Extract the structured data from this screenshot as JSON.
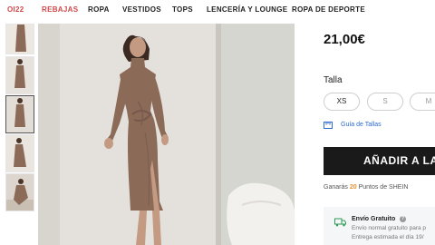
{
  "nav": {
    "items": [
      {
        "label": "OI22",
        "accent": true
      },
      {
        "label": "REBAJAS",
        "accent": true
      },
      {
        "label": "ROPA",
        "accent": false
      },
      {
        "label": "VESTIDOS",
        "accent": false
      },
      {
        "label": "TOPS",
        "accent": false
      },
      {
        "label": "LENCERÍA Y LOUNGE",
        "accent": false
      },
      {
        "label": "ROPA DE DEPORTE",
        "accent": false
      }
    ]
  },
  "product": {
    "price": "21,00€",
    "size_label": "Talla",
    "sizes": [
      {
        "label": "XS",
        "available": true
      },
      {
        "label": "S",
        "available": false
      },
      {
        "label": "M",
        "available": false
      }
    ],
    "size_guide": "Guía de Tallas",
    "add_to_cart": "AÑADIR A LA",
    "points": {
      "prefix": "Ganarás",
      "value": "20",
      "suffix": "Puntos de SHEIN"
    },
    "shipping": {
      "title": "Envío Gratuito",
      "line1": "Envío normal gratuito para p",
      "line2": "Entrega estimada el día 19/"
    }
  },
  "icons": {
    "size_guide": "ruler-icon",
    "shipping": "truck-icon",
    "help": "question-icon"
  },
  "colors": {
    "accent": "#d0484a",
    "dress": "#8b6a58",
    "button": "#1a1a1a",
    "link": "#2a6ad1",
    "points": "#e8912f"
  }
}
